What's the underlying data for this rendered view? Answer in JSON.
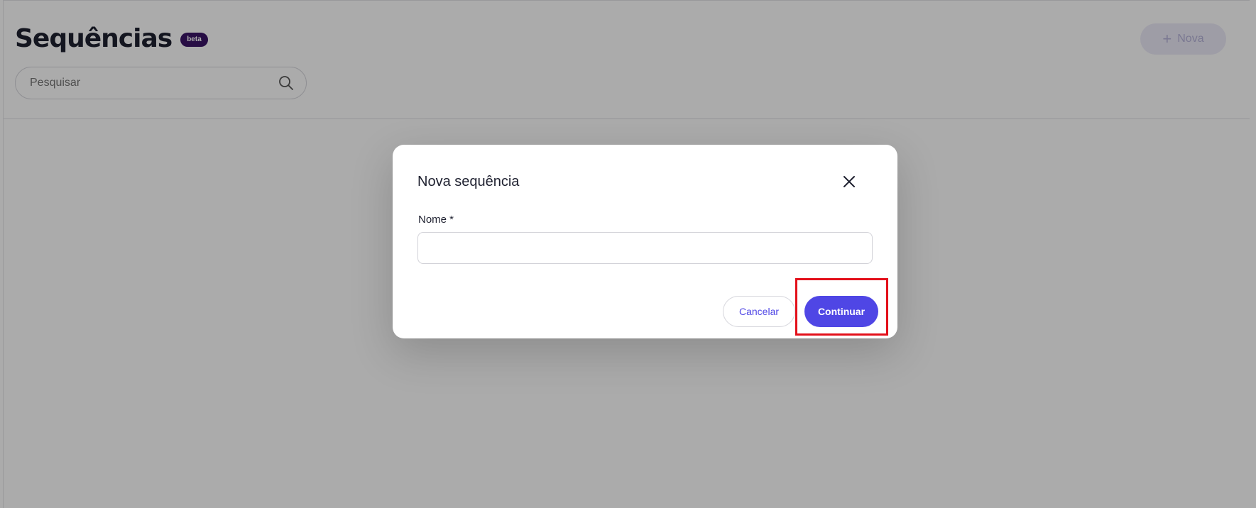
{
  "page": {
    "title": "Sequências",
    "badge": "beta",
    "new_button": {
      "icon": "plus-icon",
      "label": "Nova"
    },
    "search": {
      "placeholder": "Pesquisar",
      "value": "",
      "icon": "search-icon"
    }
  },
  "modal": {
    "title": "Nova sequência",
    "close_icon": "close-icon",
    "name_field": {
      "label": "Nome *",
      "value": ""
    },
    "cancel_label": "Cancelar",
    "continue_label": "Continuar"
  },
  "colors": {
    "accent": "#4f46e5",
    "badge_bg": "#3b1466",
    "highlight": "#e3101a"
  }
}
